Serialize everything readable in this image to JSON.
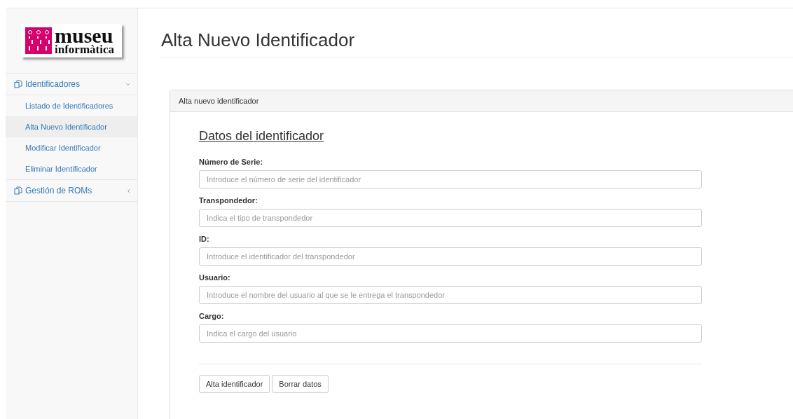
{
  "logo": {
    "line_1": "museu",
    "line_2": "informàtica"
  },
  "sidebar": {
    "items": [
      {
        "label": "Identificadores",
        "expanded": true,
        "children": [
          {
            "label": "Listado de Identificadores",
            "selected": false
          },
          {
            "label": "Alta Nuevo Identificador",
            "selected": true
          },
          {
            "label": "Modificar Identificador",
            "selected": false
          },
          {
            "label": "Eliminar Identificador",
            "selected": false
          }
        ]
      },
      {
        "label": "Gestión de ROMs",
        "expanded": false
      }
    ]
  },
  "page_title": "Alta Nuevo Identificador",
  "panel": {
    "heading": "Alta nuevo identificador",
    "section_title": "Datos del identificador",
    "fields": [
      {
        "label": "Número de Serie:",
        "placeholder": "Introduce el número de serie del identificador"
      },
      {
        "label": "Transpondedor:",
        "placeholder": "Indica el tipo de transpondedor"
      },
      {
        "label": "ID:",
        "placeholder": "Introduce el identificador del transpondedor"
      },
      {
        "label": "Usuario:",
        "placeholder": "Introduce el nombre del usuario al que se le entrega el transpondedor"
      },
      {
        "label": "Cargo:",
        "placeholder": "Indica el cargo del usuario"
      }
    ],
    "buttons": [
      "Alta identificador",
      "Borrar datos"
    ]
  }
}
